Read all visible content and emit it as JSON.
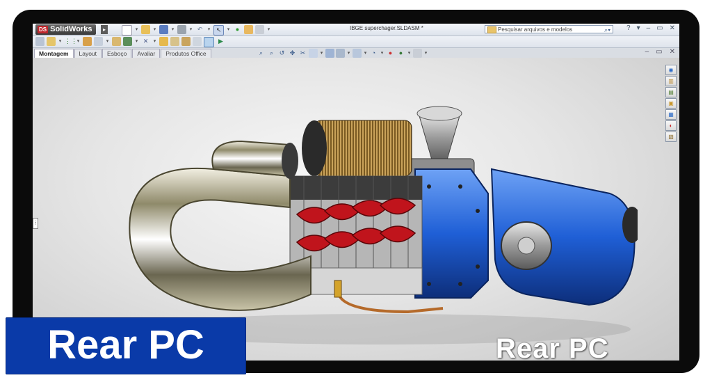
{
  "app": {
    "logo_text": "SolidWorks",
    "logo_badge": "DS",
    "document_title": "IBGE superchager.SLDASM *",
    "search_placeholder": "Pesquisar arquivos e modelos",
    "window_buttons": [
      "?",
      "▾",
      "–",
      "▭",
      "✕"
    ]
  },
  "tabs": [
    {
      "label": "Montagem",
      "active": true
    },
    {
      "label": "Layout",
      "active": false
    },
    {
      "label": "Esboço",
      "active": false
    },
    {
      "label": "Avaliar",
      "active": false
    },
    {
      "label": "Produtos Office",
      "active": false
    }
  ],
  "viewport": {
    "watermark_text": "Rear PC",
    "window_buttons": [
      "–",
      "▭",
      "✕"
    ]
  },
  "banner": {
    "label": "Rear PC",
    "color": "#0a3aa8"
  },
  "colors": {
    "housing_blue": "#1f5fd6",
    "rotor_red": "#c0141c",
    "chrome": "#b9b5a0",
    "filter_bronze": "#8a6a2a"
  },
  "icons": {
    "taskpane": [
      "sw-resources-icon",
      "design-library-icon",
      "file-explorer-icon",
      "view-palette-icon",
      "appearances-icon",
      "custom-properties-icon",
      "search-results-icon"
    ]
  }
}
